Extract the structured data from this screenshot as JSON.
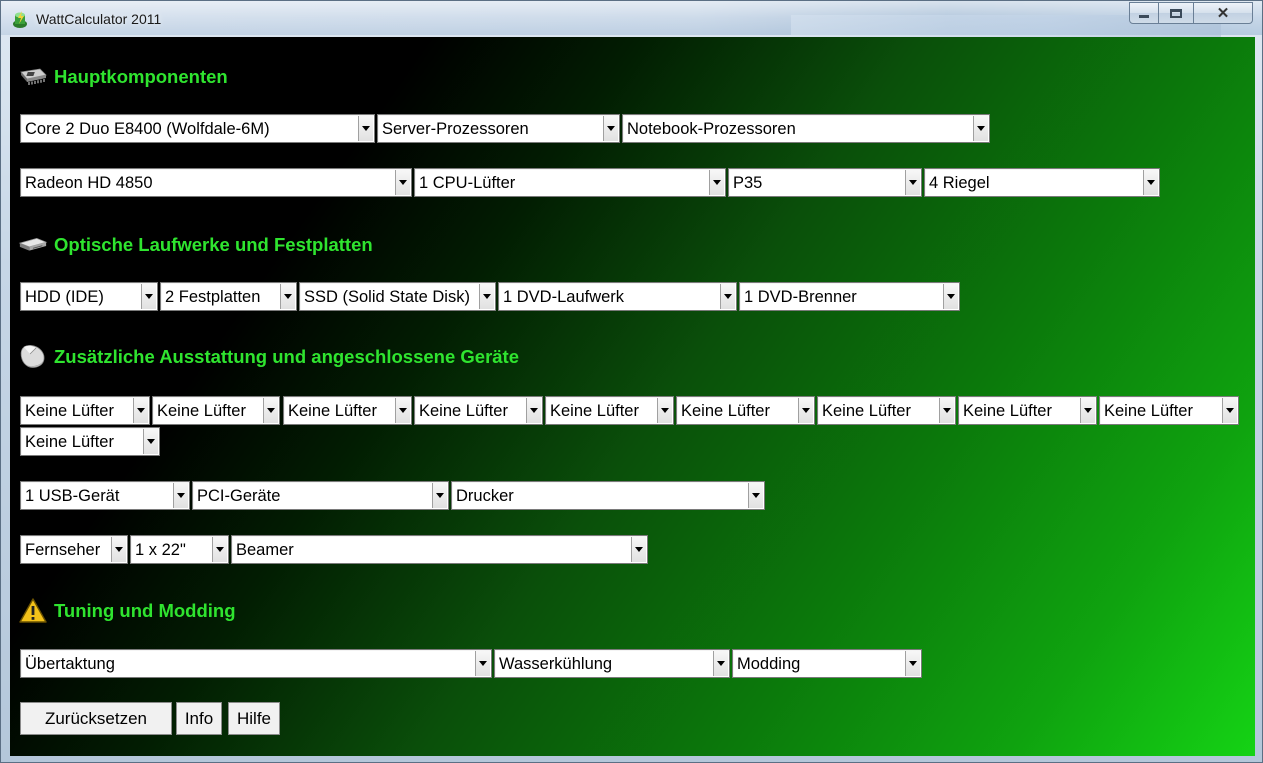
{
  "window": {
    "title": "WattCalculator 2011"
  },
  "sections": {
    "main": {
      "title": "Hauptkomponenten",
      "icon": "cpu-chip-icon"
    },
    "drives": {
      "title": "Optische Laufwerke und Festplatten",
      "icon": "drive-icon"
    },
    "extras": {
      "title": "Zusätzliche Ausstattung und angeschlossene Geräte",
      "icon": "mouse-icon"
    },
    "tuning": {
      "title": "Tuning und Modding",
      "icon": "warning-icon"
    }
  },
  "main": {
    "cpu": "Core 2 Duo E8400 (Wolfdale-6M)",
    "server_cpu": "Server-Prozessoren",
    "notebook_cpu": "Notebook-Prozessoren",
    "gpu": "Radeon HD 4850",
    "cpu_fan": "1 CPU-Lüfter",
    "chipset": "P35",
    "ram": "4 Riegel"
  },
  "drives": {
    "hdd_type": "HDD (IDE)",
    "hdd_count": "2 Festplatten",
    "ssd": "SSD (Solid State Disk)",
    "dvd": "1 DVD-Laufwerk",
    "dvd_burner": "1 DVD-Brenner"
  },
  "extras": {
    "fans": [
      "Keine Lüfter",
      "Keine Lüfter",
      "Keine Lüfter",
      "Keine Lüfter",
      "Keine Lüfter",
      "Keine Lüfter",
      "Keine Lüfter",
      "Keine Lüfter",
      "Keine Lüfter",
      "Keine Lüfter"
    ],
    "usb": "1 USB-Gerät",
    "pci": "PCI-Geräte",
    "printer": "Drucker",
    "tv": "Fernseher",
    "monitor": "1 x 22\"",
    "projector": "Beamer"
  },
  "tuning": {
    "overclock": "Übertaktung",
    "water": "Wasserkühlung",
    "modding": "Modding"
  },
  "buttons": {
    "reset": "Zurücksetzen",
    "info": "Info",
    "help": "Hilfe"
  },
  "colors": {
    "section_title": "#2fe42f",
    "background_dark": "#000000",
    "background_green": "#15d315"
  }
}
